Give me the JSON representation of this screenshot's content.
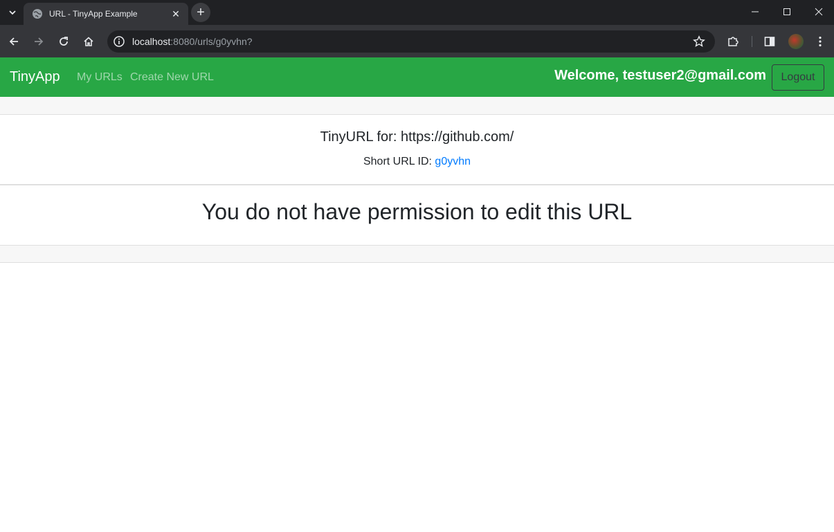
{
  "browser": {
    "tab_title": "URL - TinyApp Example",
    "url_host": "localhost",
    "url_rest": ":8080/urls/g0yvhn?"
  },
  "navbar": {
    "brand": "TinyApp",
    "links": [
      "My URLs",
      "Create New URL"
    ],
    "welcome": "Welcome, testuser2@gmail.com",
    "logout": "Logout"
  },
  "card": {
    "title": "TinyURL for: https://github.com/",
    "short_label": "Short URL ID: ",
    "short_id": "g0yvhn",
    "message": "You do not have permission to edit this URL"
  },
  "colors": {
    "navbar": "#28a745",
    "link": "#007bff"
  }
}
